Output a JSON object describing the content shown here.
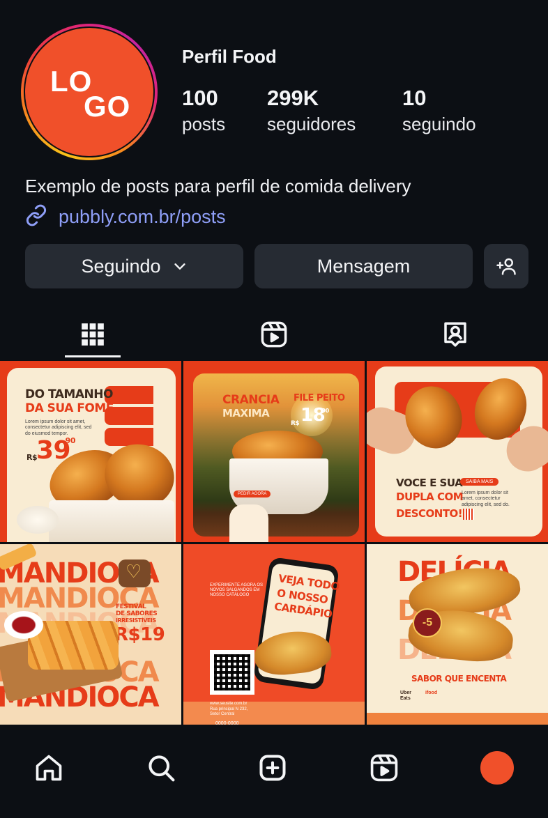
{
  "profile": {
    "logo_line1": "LO",
    "logo_line2": "GO",
    "name": "Perfil Food",
    "stats": [
      {
        "value": "100",
        "label": "posts"
      },
      {
        "value": "299K",
        "label": "seguidores"
      },
      {
        "value": "10",
        "label": "seguindo"
      }
    ],
    "bio": "Exemplo de posts para perfil de comida delivery",
    "link": "pubbly.com.br/posts"
  },
  "actions": {
    "following_label": "Seguindo",
    "message_label": "Mensagem"
  },
  "tabs": [
    {
      "icon": "grid-icon",
      "active": true
    },
    {
      "icon": "reels-icon",
      "active": false
    },
    {
      "icon": "tagged-icon",
      "active": false
    }
  ],
  "posts": {
    "p1": {
      "line1": "DO TAMANHO",
      "line2": "DA SUA FOME",
      "currency": "R$",
      "price": "39",
      "cents": ",90"
    },
    "p2": {
      "line1": "CRANCIA",
      "line2": "MAXIMA",
      "title_right": "FILE PEITO",
      "currency": "R$",
      "price": "18",
      "cents": ",90",
      "cta": "PEDIR AGORA"
    },
    "p3": {
      "line1": "VOCE E SUA",
      "line2": "DUPLA COM",
      "line3": "DESCONTO!",
      "cta": "SAIBA MAIS"
    },
    "p4": {
      "word": "MANDIOCA",
      "festival1": "FESTIVAL",
      "festival2": "DE SABORES",
      "festival3": "IRRESISTÍVEIS",
      "price": "R$19"
    },
    "p5": {
      "headline1": "VEJA TODO",
      "headline2": "O NOSSO",
      "headline3": "CARDÁPIO",
      "intro": "EXPERIMENTE AGORA OS NOVOS SALGANDOS EM NOSSO CATÁLOGO",
      "site": "www.seusite.com.br",
      "address": "Rua principal N 232, Setor Central",
      "phone": "0000-0000"
    },
    "p6": {
      "word": "DELÍCIA",
      "badge": "-5",
      "tagline": "SABOR QUE ENCENTA",
      "brand1": "Uber Eats",
      "brand2": "ifood"
    }
  },
  "colors": {
    "accent": "#f0502a",
    "link": "#8f9ff8",
    "button_bg": "#262b33",
    "background": "#0c0f14"
  },
  "bottom_nav": [
    {
      "icon": "home-icon"
    },
    {
      "icon": "search-icon"
    },
    {
      "icon": "create-icon"
    },
    {
      "icon": "reels-icon"
    },
    {
      "icon": "profile-avatar"
    }
  ]
}
